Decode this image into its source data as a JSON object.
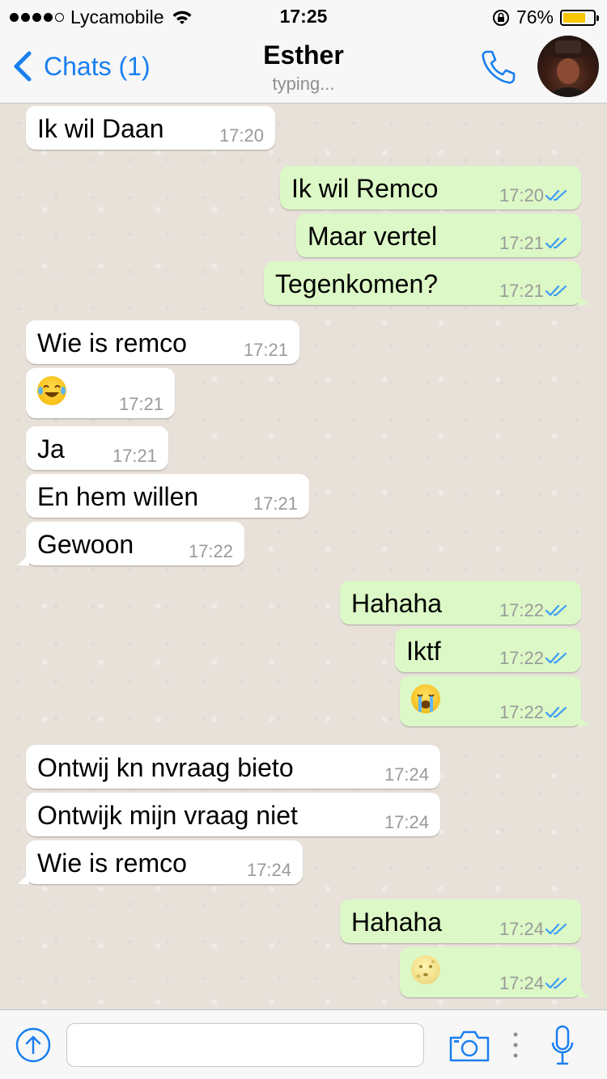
{
  "status_bar": {
    "carrier": "Lycamobile",
    "time": "17:25",
    "battery_percent": "76%",
    "battery_level": 0.76,
    "signal_bars": 4
  },
  "header": {
    "back_label": "Chats (1)",
    "title": "Esther",
    "subtitle": "typing...",
    "call_icon": "phone-icon",
    "avatar": "contact-avatar"
  },
  "messages": [
    {
      "dir": "in",
      "text": "Ik wil Daan",
      "time": "17:20"
    },
    {
      "dir": "out",
      "text": "Ik wil Remco",
      "time": "17:20"
    },
    {
      "dir": "out",
      "text": "Maar vertel",
      "time": "17:21"
    },
    {
      "dir": "out",
      "text": "Tegenkomen?",
      "time": "17:21"
    },
    {
      "dir": "in",
      "text": "Wie is remco",
      "time": "17:21"
    },
    {
      "dir": "in",
      "emoji": "face-with-tears-of-joy",
      "time": "17:21"
    },
    {
      "dir": "in",
      "text": "Ja",
      "time": "17:21"
    },
    {
      "dir": "in",
      "text": "En hem willen",
      "time": "17:21"
    },
    {
      "dir": "in",
      "text": "Gewoon",
      "time": "17:22"
    },
    {
      "dir": "out",
      "text": "Hahaha",
      "time": "17:22"
    },
    {
      "dir": "out",
      "text": "Iktf",
      "time": "17:22"
    },
    {
      "dir": "out",
      "emoji": "loudly-crying-face",
      "time": "17:22"
    },
    {
      "dir": "in",
      "text": "Ontwij kn nvraag bieto",
      "time": "17:24"
    },
    {
      "dir": "in",
      "text": "Ontwijk mijn vraag niet",
      "time": "17:24"
    },
    {
      "dir": "in",
      "text": "Wie is remco",
      "time": "17:24"
    },
    {
      "dir": "out",
      "text": "Hahaha",
      "time": "17:24"
    },
    {
      "dir": "out",
      "emoji": "moon-face",
      "time": "17:24"
    }
  ],
  "input_bar": {
    "share_icon": "share-up-arrow-icon",
    "placeholder": "",
    "value": "",
    "camera_icon": "camera-icon",
    "mic_icon": "microphone-icon"
  },
  "colors": {
    "accent": "#1a7ff0",
    "incoming_bubble": "#ffffff",
    "outgoing_bubble": "#dcf8c6",
    "chat_background": "#e5ddd5",
    "battery": "#f7c600"
  }
}
